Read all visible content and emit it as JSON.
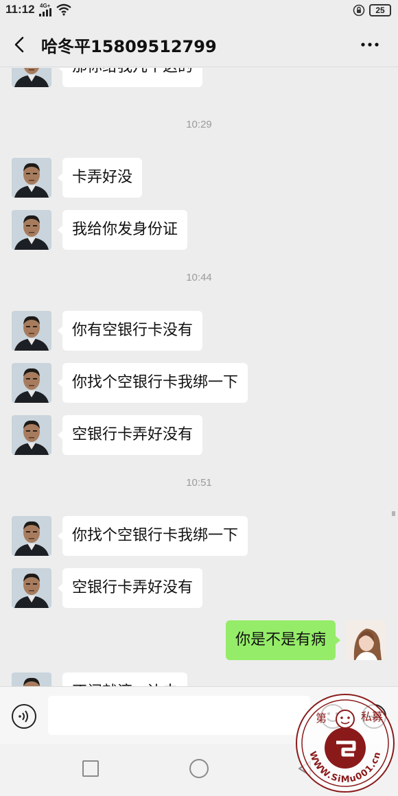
{
  "status_bar": {
    "time": "11:12",
    "network": "4G+",
    "battery": "25"
  },
  "header": {
    "title": "哈冬平15809512799"
  },
  "messages": [
    {
      "kind": "text",
      "side": "left",
      "text": "那你给我几个这的"
    },
    {
      "kind": "time",
      "text": "10:29"
    },
    {
      "kind": "text",
      "side": "left",
      "text": "卡弄好没"
    },
    {
      "kind": "text",
      "side": "left",
      "text": "我给你发身份证"
    },
    {
      "kind": "time",
      "text": "10:44"
    },
    {
      "kind": "text",
      "side": "left",
      "text": "你有空银行卡没有"
    },
    {
      "kind": "text",
      "side": "left",
      "text": "你找个空银行卡我绑一下"
    },
    {
      "kind": "text",
      "side": "left",
      "text": "空银行卡弄好没有"
    },
    {
      "kind": "time",
      "text": "10:51"
    },
    {
      "kind": "text",
      "side": "left",
      "text": "你找个空银行卡我绑一下"
    },
    {
      "kind": "text",
      "side": "left",
      "text": "空银行卡弄好没有"
    },
    {
      "kind": "text",
      "side": "right",
      "text": "你是不是有病"
    },
    {
      "kind": "text",
      "side": "left",
      "text": "不闹就滚一边去"
    }
  ],
  "input": {
    "value": "",
    "placeholder": ""
  },
  "icons": {
    "back": "back-arrow-icon",
    "more": "more-dots-icon",
    "voice": "voice-icon",
    "emoji": "emoji-icon",
    "plus": "plus-icon"
  },
  "watermark": {
    "text_left": "第",
    "text_right": "私募",
    "url": "WWW.SiMu001.cn"
  },
  "colors": {
    "background": "#ededed",
    "incoming_bubble": "#ffffff",
    "outgoing_bubble": "#95ec69",
    "watermark": "#8a1a1a"
  }
}
